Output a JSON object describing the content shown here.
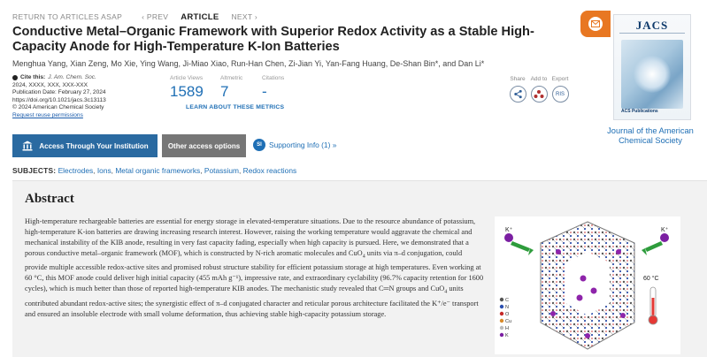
{
  "nav": {
    "return": "RETURN TO ARTICLES ASAP",
    "prev": "‹ PREV",
    "current": "ARTICLE",
    "next": "NEXT ›"
  },
  "article": {
    "title": "Conductive Metal–Organic Framework with Superior Redox Activity as a Stable High-Capacity Anode for High-Temperature K-Ion Batteries",
    "authors": "Menghua Yang, Xian Zeng, Mo Xie, Ying Wang, Ji-Miao Xiao, Run-Han Chen, Zi-Jian Yi, Yan-Fang Huang, De-Shan Bin*, and Dan Li*"
  },
  "citation": {
    "cite_label": "Cite this:",
    "cite_journal": "J. Am. Chem. Soc.",
    "cite_rest": "2024, XXXX, XXX, XXX-XXX",
    "pub_date": "Publication Date: February 27, 2024",
    "doi": "https://doi.org/10.1021/jacs.3c13113",
    "copyright": "© 2024 American Chemical Society",
    "reuse": "Request reuse permissions"
  },
  "metrics": {
    "views_label": "Article Views",
    "views": "1589",
    "altmetric_label": "Altmetric",
    "altmetric": "7",
    "citations_label": "Citations",
    "citations": "-",
    "learn": "LEARN ABOUT THESE METRICS"
  },
  "share": {
    "share_label": "Share",
    "add_label": "Add to",
    "export_label": "Export",
    "export_format": "RIS"
  },
  "journal": {
    "cover_title": "JACS",
    "cover_footer": "ACS Publications",
    "name": "Journal of the American Chemical Society"
  },
  "access": {
    "institution_button": "Access Through Your Institution",
    "other_button": "Other access options",
    "si_badge": "SI",
    "si_link": "Supporting Info (1) »"
  },
  "subjects": {
    "label": "SUBJECTS:",
    "items": [
      "Electrodes",
      "Ions",
      "Metal organic frameworks",
      "Potassium",
      "Redox reactions"
    ]
  },
  "abstract": {
    "heading": "Abstract",
    "p1": "High-temperature rechargeable batteries are essential for energy storage in elevated-temperature situations. Due to the resource abundance of potassium, high-temperature K-ion batteries are drawing increasing research interest. However, raising the working temperature would aggravate the chemical and mechanical instability of the KIB anode, resulting in very fast capacity fading, especially when high capacity is pursued. Here, we demonstrated that a porous conductive metal–organic framework (MOF), which is constructed by N-rich aromatic molecules and CuO",
    "p1_sub": "4",
    "p2": " units via π–d conjugation, could provide multiple accessible redox-active sites and promised robust structure stability for efficient potassium storage at high temperatures. Even working at 60 °C, this MOF anode could deliver high initial capacity (455 mAh g⁻¹), impressive rate, and extraordinary cyclability (96.7% capacity retention for 1600 cycles), which is much better than those of reported high-temperature KIB anodes. The mechanistic study revealed that C═N groups and CuO",
    "p2_sub": "4",
    "p3": " units contributed abundant redox-active sites; the synergistic effect of π–d conjugated character and reticular porous architecture facilitated the K⁺/e⁻ transport and ensured an insoluble electrode with small volume deformation, thus achieving stable high-capacity potassium storage."
  },
  "toc_graphic": {
    "temperature": "60 °C",
    "ion_label": "K⁺",
    "legend": [
      "C",
      "N",
      "O",
      "Cu",
      "H",
      "K"
    ]
  }
}
